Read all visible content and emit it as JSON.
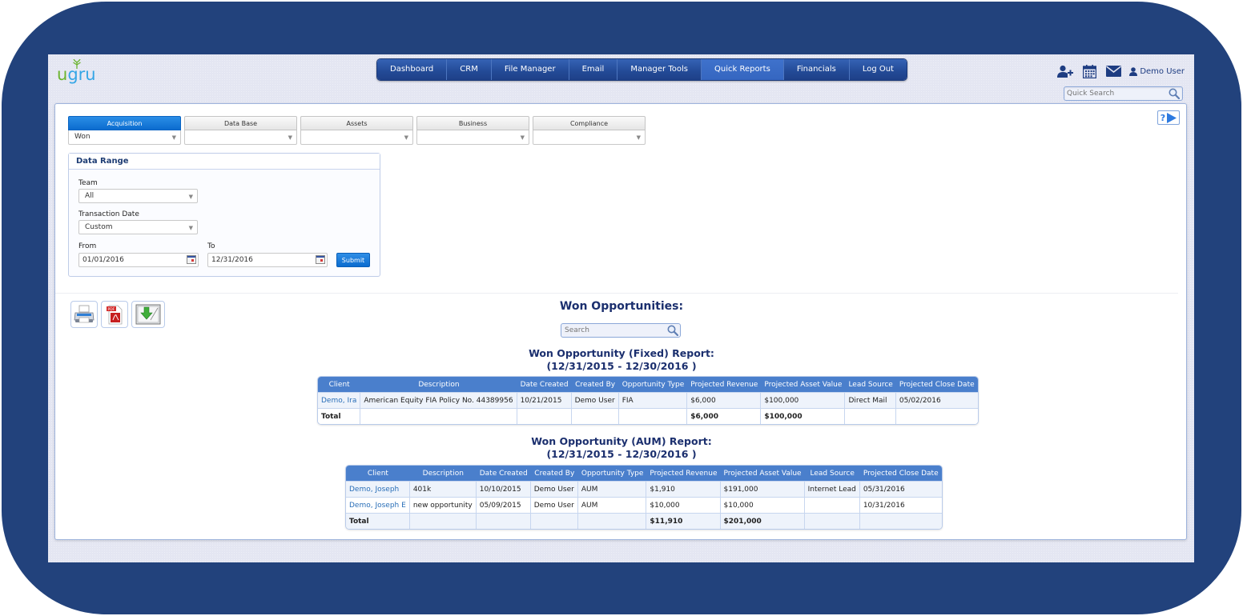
{
  "brand": {
    "logo_text": [
      "u",
      "g",
      "r",
      "u"
    ]
  },
  "nav": {
    "items": [
      {
        "label": "Dashboard"
      },
      {
        "label": "CRM"
      },
      {
        "label": "File Manager"
      },
      {
        "label": "Email"
      },
      {
        "label": "Manager Tools"
      },
      {
        "label": "Quick Reports",
        "active": true
      },
      {
        "label": "Financials"
      },
      {
        "label": "Log Out"
      }
    ]
  },
  "header": {
    "user_name": "Demo User",
    "quick_search_placeholder": "Quick Search",
    "help_label": "?"
  },
  "categories": [
    {
      "label": "Acquisition",
      "value": "Won",
      "active": true
    },
    {
      "label": "Data Base",
      "value": ""
    },
    {
      "label": "Assets",
      "value": ""
    },
    {
      "label": "Business",
      "value": ""
    },
    {
      "label": "Compliance",
      "value": ""
    }
  ],
  "range": {
    "title": "Data Range",
    "team_label": "Team",
    "team_value": "All",
    "txn_label": "Transaction Date",
    "txn_value": "Custom",
    "from_label": "From",
    "from_value": "01/01/2016",
    "to_label": "To",
    "to_value": "12/31/2016",
    "submit_label": "Submit"
  },
  "report": {
    "title": "Won Opportunities:",
    "search_placeholder": "Search",
    "fixed": {
      "title": "Won Opportunity (Fixed) Report:",
      "range": "(12/31/2015 - 12/30/2016 )",
      "columns": [
        "Client",
        "Description",
        "Date Created",
        "Created By",
        "Opportunity Type",
        "Projected Revenue",
        "Projected Asset Value",
        "Lead Source",
        "Projected Close Date"
      ],
      "rows": [
        [
          "Demo, Ira",
          "American Equity FIA Policy No. 44389956",
          "10/21/2015",
          "Demo User",
          "FIA",
          "$6,000",
          "$100,000",
          "Direct Mail",
          "05/02/2016"
        ]
      ],
      "total": [
        "Total",
        "",
        "",
        "",
        "",
        "$6,000",
        "$100,000",
        "",
        ""
      ]
    },
    "aum": {
      "title": "Won Opportunity (AUM) Report:",
      "range": "(12/31/2015 - 12/30/2016 )",
      "columns": [
        "Client",
        "Description",
        "Date Created",
        "Created By",
        "Opportunity Type",
        "Projected Revenue",
        "Projected Asset Value",
        "Lead Source",
        "Projected Close Date"
      ],
      "rows": [
        [
          "Demo, Joseph",
          "401k",
          "10/10/2015",
          "Demo User",
          "AUM",
          "$1,910",
          "$191,000",
          "Internet Lead",
          "05/31/2016"
        ],
        [
          "Demo, Joseph E",
          "new opportunity",
          "05/09/2015",
          "Demo User",
          "AUM",
          "$10,000",
          "$10,000",
          "",
          "10/31/2016"
        ]
      ],
      "total": [
        "Total",
        "",
        "",
        "",
        "",
        "$11,910",
        "$201,000",
        "",
        ""
      ]
    }
  },
  "colors": {
    "frame": "#22427c",
    "nav": "#234a96",
    "accent": "#0b6ccf",
    "table_header": "#4a7fcc",
    "heading": "#1b2f6e",
    "link": "#2a6fb8"
  }
}
